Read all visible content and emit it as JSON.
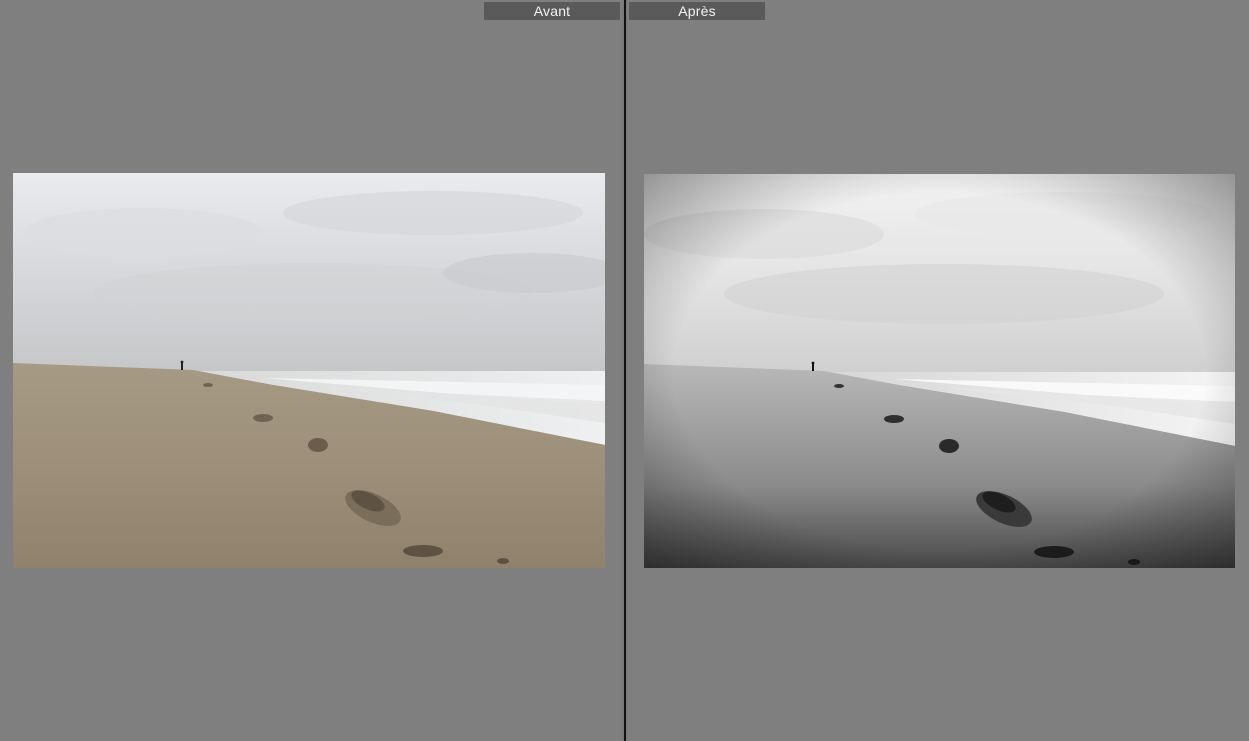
{
  "compare_view": {
    "before_label": "Avant",
    "after_label": "Après"
  },
  "colors": {
    "background": "#7f7f7f",
    "label_bg": "#5a5a5a",
    "divider": "#111111"
  }
}
